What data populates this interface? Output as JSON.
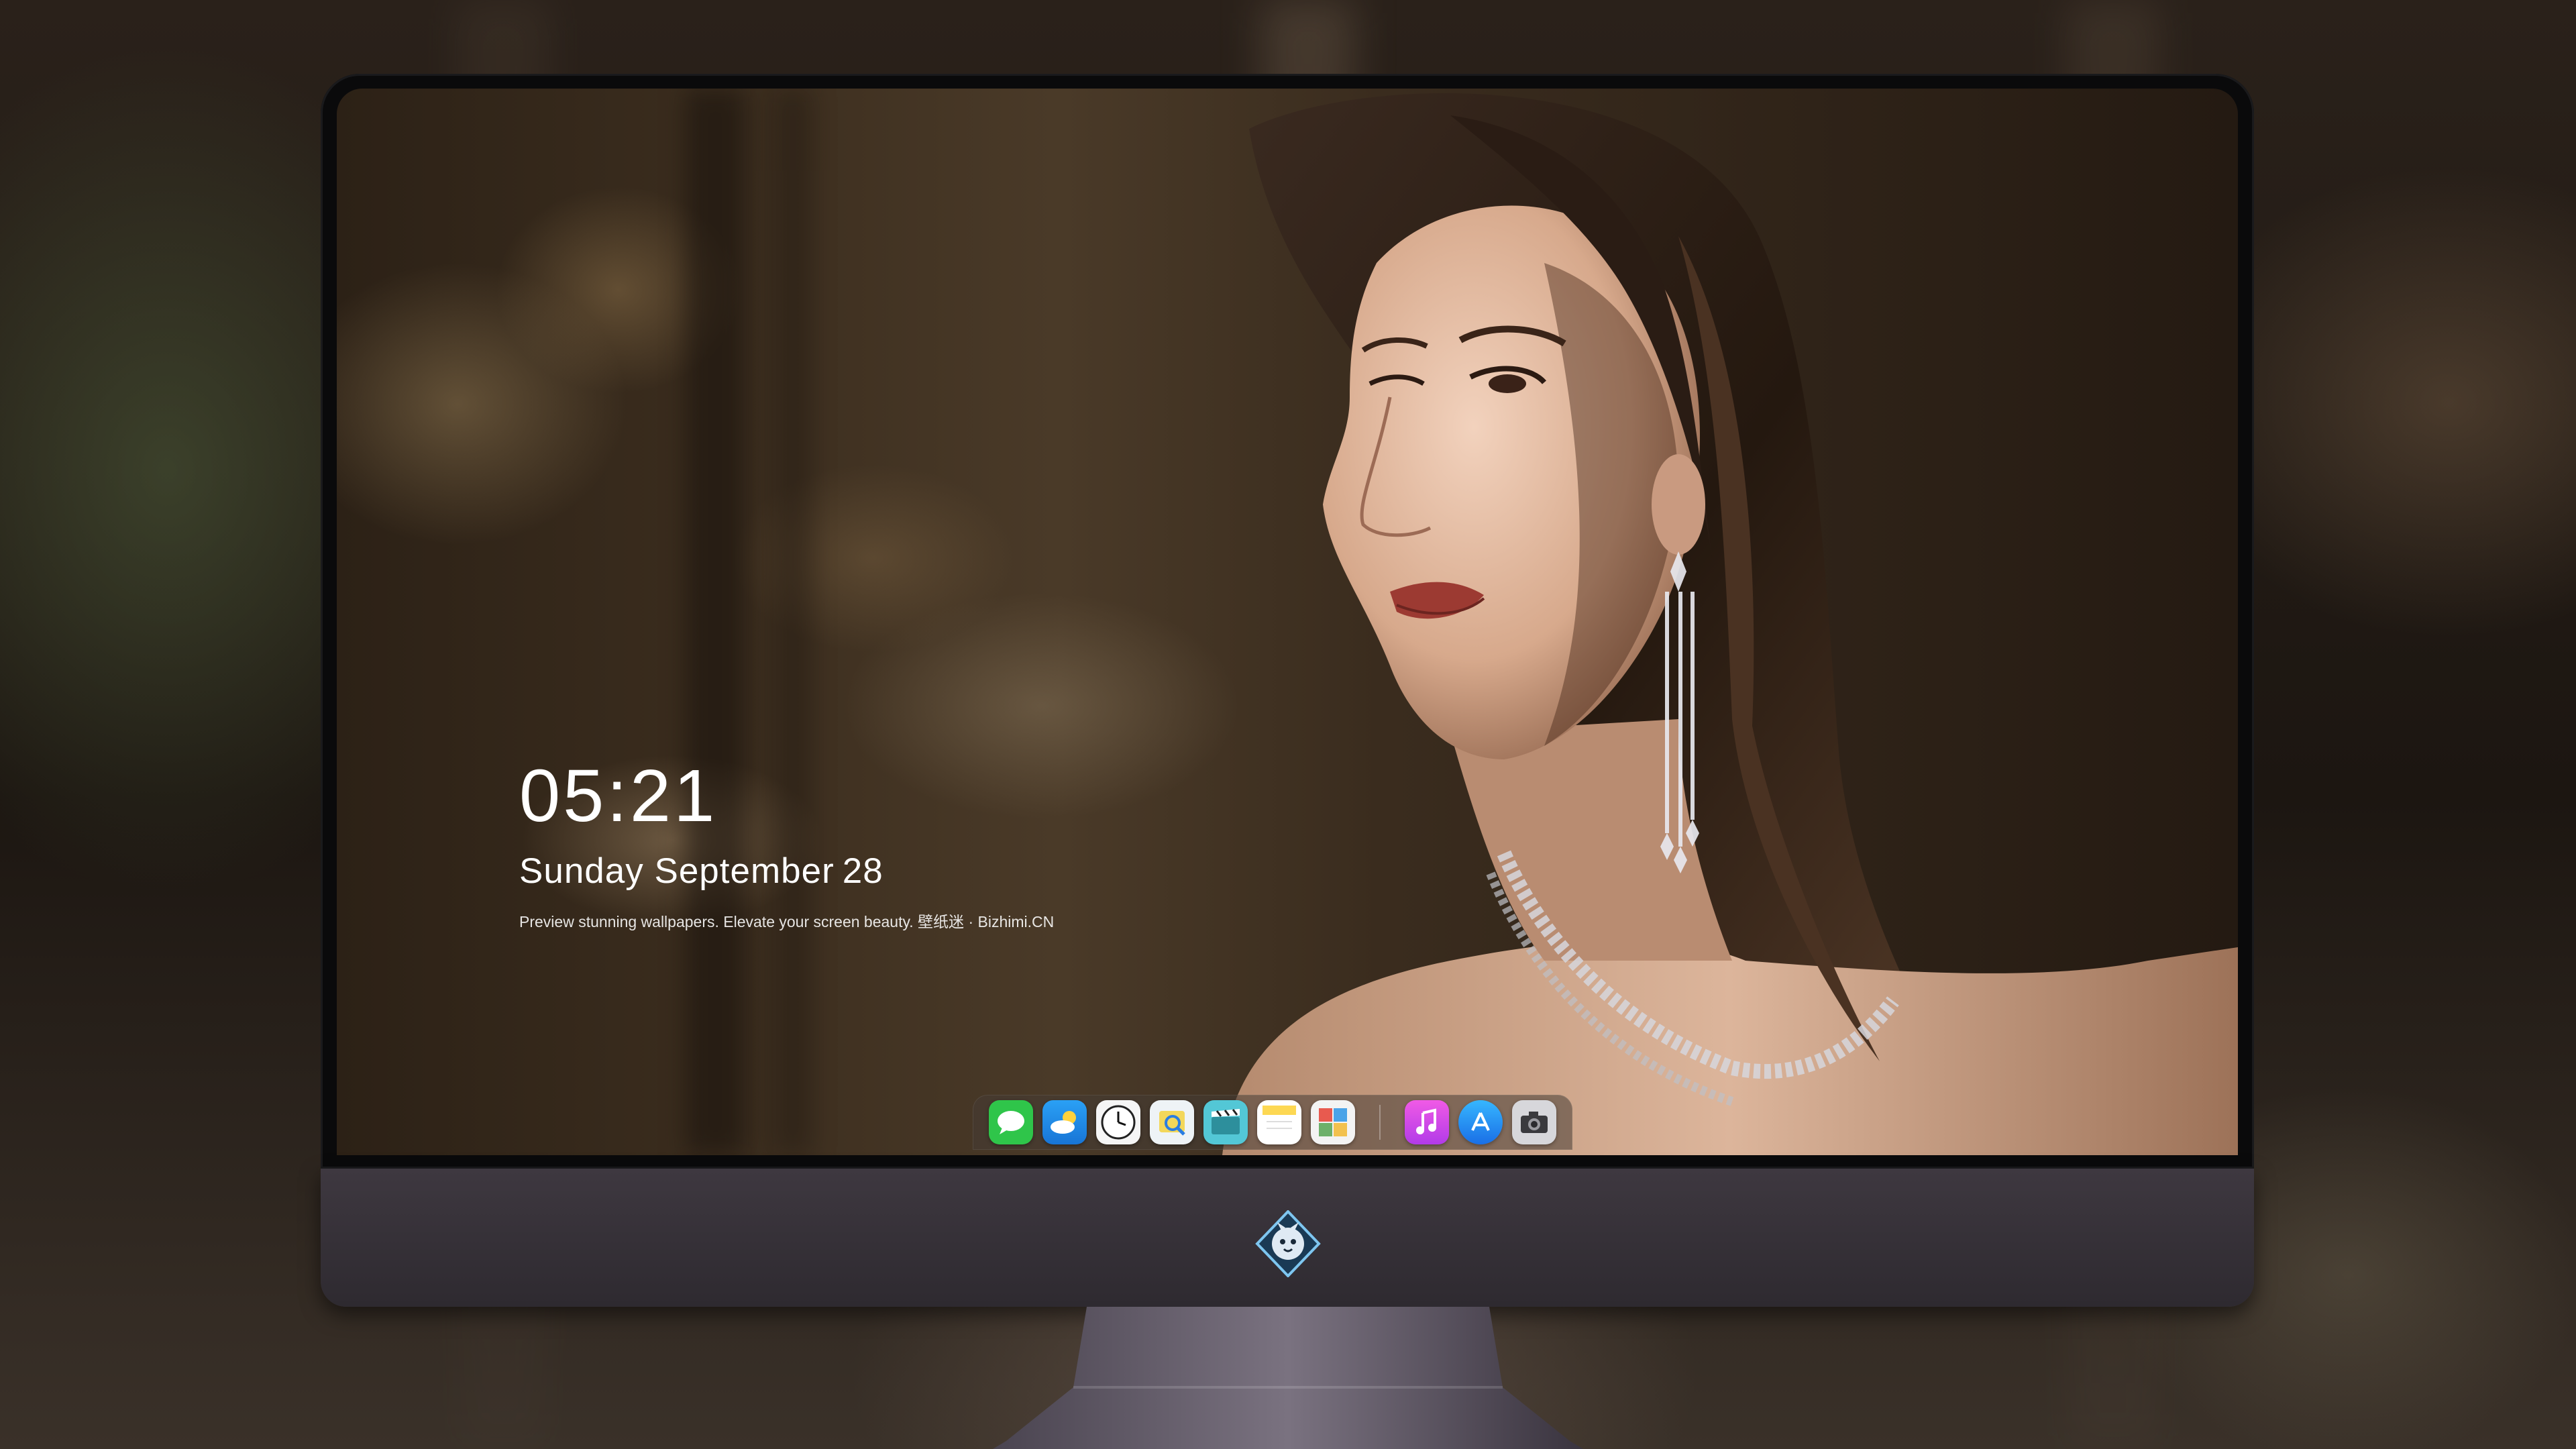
{
  "lock_screen": {
    "time": "05:21",
    "weekday_month": "Sunday September",
    "day": "28",
    "tagline": "Preview stunning wallpapers. Elevate your screen beauty. 壁纸迷 · Bizhimi.CN"
  },
  "dock": {
    "apps": [
      {
        "name": "messages-icon",
        "color": "#2fc54a"
      },
      {
        "name": "weather-icon",
        "color": "#1e8fe8"
      },
      {
        "name": "clock-icon",
        "color": "#f5f5f5"
      },
      {
        "name": "preview-icon",
        "color": "#f3d75a"
      },
      {
        "name": "video-icon",
        "color": "#53c7d6"
      },
      {
        "name": "notes-icon",
        "color": "#fdd853"
      },
      {
        "name": "photo-booth-icon",
        "color": "#6db06a"
      },
      {
        "name": "music-icon",
        "color": "#e04ad9"
      },
      {
        "name": "app-store-icon",
        "color": "#1e8ff0"
      },
      {
        "name": "camera-icon",
        "color": "#c9c9cc"
      }
    ]
  },
  "colors": {
    "monitor_chin": "#3e3840",
    "bezel": "#0a0a0b",
    "dock_bg": "rgba(70,60,52,.55)"
  }
}
